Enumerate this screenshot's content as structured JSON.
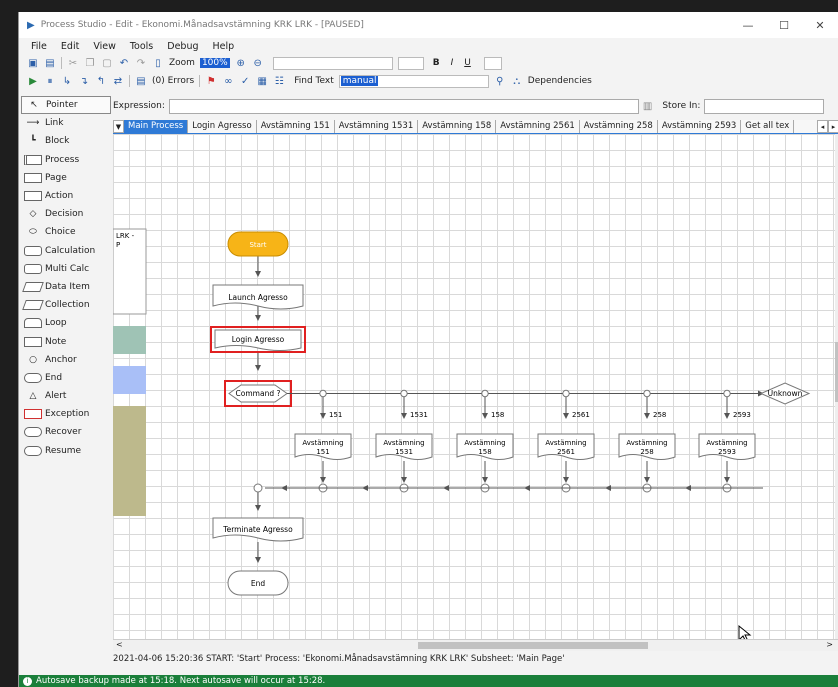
{
  "window": {
    "title": "Process Studio  - Edit - Ekonomi.Månadsavstämning KRK LRK - [PAUSED]",
    "minimize": "—",
    "maximize": "☐",
    "close": "✕"
  },
  "menu": [
    "File",
    "Edit",
    "View",
    "Tools",
    "Debug",
    "Help"
  ],
  "toolbar1": {
    "zoom_label": "Zoom",
    "zoom_value": "100%",
    "bold": "B",
    "italic": "I",
    "underline": "U"
  },
  "toolbar2": {
    "errors": "(0) Errors",
    "find_label": "Find Text",
    "find_value": "manual",
    "dependencies": "Dependencies"
  },
  "toolbox": [
    "Pointer",
    "Link",
    "Block",
    "Process",
    "Page",
    "Action",
    "Decision",
    "Choice",
    "Calculation",
    "Multi Calc",
    "Data Item",
    "Collection",
    "Loop",
    "Note",
    "Anchor",
    "End",
    "Alert",
    "Exception",
    "Recover",
    "Resume"
  ],
  "expression_label": "Expression:",
  "store_in_label": "Store In:",
  "tabs": [
    "Main Process",
    "Login Agresso",
    "Avstämning 151",
    "Avstämning 1531",
    "Avstämning 158",
    "Avstämning 2561",
    "Avstämning 258",
    "Avstämning 2593",
    "Get all tex"
  ],
  "diagram": {
    "side_block": "LRK -\nP",
    "start": "Start",
    "launch": "Launch Agresso",
    "login": "Login Agresso",
    "choice": "Command ?",
    "unknown": "Unknown",
    "branches": [
      {
        "label": "151",
        "action": "Avstämning\n151"
      },
      {
        "label": "1531",
        "action": "Avstämning\n1531"
      },
      {
        "label": "158",
        "action": "Avstämning\n158"
      },
      {
        "label": "2561",
        "action": "Avstämning\n2561"
      },
      {
        "label": "258",
        "action": "Avstämning\n258"
      },
      {
        "label": "2593",
        "action": "Avstämning\n2593"
      }
    ],
    "terminate": "Terminate Agresso",
    "end": "End"
  },
  "log_line": "2021-04-06 15:20:36 START: 'Start' Process: 'Ekonomi.Månadsavstämning KRK LRK' Subsheet: 'Main Page'",
  "status": "Autosave backup made at 15:18. Next autosave will occur at 15:28.",
  "colors": {
    "start_fill": "#f7b417",
    "highlight": "#e02020",
    "tab_active": "#2f7ad6",
    "status_bar": "#1a7f3a"
  }
}
